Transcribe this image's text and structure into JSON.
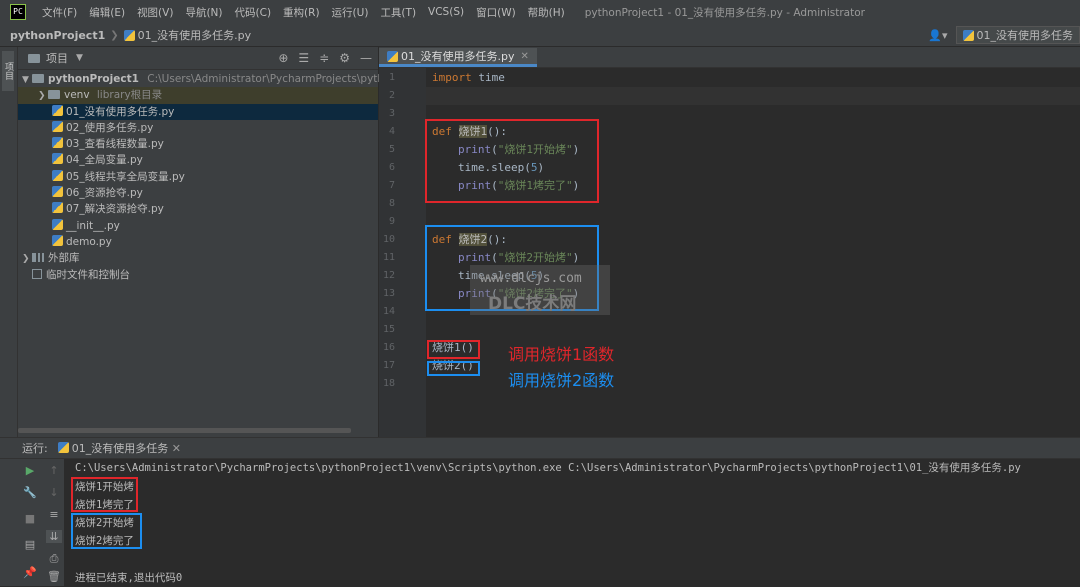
{
  "menubar": {
    "items": [
      "文件(F)",
      "编辑(E)",
      "视图(V)",
      "导航(N)",
      "代码(C)",
      "重构(R)",
      "运行(U)",
      "工具(T)",
      "VCS(S)",
      "窗口(W)",
      "帮助(H)"
    ],
    "window_title": "pythonProject1 - 01_没有使用多任务.py - Administrator"
  },
  "navbar": {
    "project": "pythonProject1",
    "file": "01_没有使用多任务.py",
    "run_config": "01_没有使用多任务"
  },
  "left_strip": {
    "tab_label": "项目"
  },
  "project_panel": {
    "title": "项目",
    "root_name": "pythonProject1",
    "root_path": "C:\\Users\\Administrator\\PycharmProjects\\pythonPro",
    "venv_name": "venv",
    "venv_note": "library根目录",
    "files": [
      "01_没有使用多任务.py",
      "02_使用多任务.py",
      "03_查看线程数量.py",
      "04_全局变量.py",
      "05_线程共享全局变量.py",
      "06_资源抢夺.py",
      "07_解决资源抢夺.py",
      "__init__.py",
      "demo.py"
    ],
    "external_libs": "外部库",
    "scratches": "临时文件和控制台"
  },
  "editor": {
    "tab": "01_没有使用多任务.py",
    "line_numbers": [
      "1",
      "2",
      "3",
      "4",
      "5",
      "6",
      "7",
      "8",
      "9",
      "10",
      "11",
      "12",
      "13",
      "14",
      "15",
      "16",
      "17",
      "18"
    ],
    "code": {
      "l1_kw": "import",
      "l1_mod": " time",
      "l4_kw": "def ",
      "l4_fn": "烧饼1",
      "l4_rest": "():",
      "l5_fn": "print",
      "l5_p1": "(",
      "l5_str": "\"烧饼1开始烤\"",
      "l5_p2": ")",
      "l6_a": "time.sleep(",
      "l6_num": "5",
      "l6_b": ")",
      "l7_fn": "print",
      "l7_p1": "(",
      "l7_str": "\"烧饼1烤完了\"",
      "l7_p2": ")",
      "l10_kw": "def ",
      "l10_fn": "烧饼2",
      "l10_rest": "():",
      "l11_fn": "print",
      "l11_p1": "(",
      "l11_str": "\"烧饼2开始烤\"",
      "l11_p2": ")",
      "l12_a": "time.sleep(",
      "l12_num": "5",
      "l12_b": ")",
      "l13_fn": "print",
      "l13_p1": "(",
      "l13_str": "\"烧饼2烤完了\"",
      "l13_p2": ")",
      "l16": "烧饼1()",
      "l17": "烧饼2()"
    },
    "annotations": {
      "call1": "调用烧饼1函数",
      "call2": "调用烧饼2函数"
    },
    "watermark": {
      "url": "www.dlcjs.com",
      "name": "DLC技术网"
    }
  },
  "run_panel": {
    "label": "运行:",
    "tab": "01_没有使用多任务",
    "command": "C:\\Users\\Administrator\\PycharmProjects\\pythonProject1\\venv\\Scripts\\python.exe C:\\Users\\Administrator\\PycharmProjects\\pythonProject1\\01_没有使用多任务.py",
    "output": [
      "烧饼1开始烤",
      "烧饼1烤完了",
      "烧饼2开始烤",
      "烧饼2烤完了"
    ],
    "exit_message": "进程已结束,退出代码0"
  },
  "colors": {
    "annotation_red": "#e0262b",
    "annotation_blue": "#1c8ef0",
    "run_green": "#59a869"
  }
}
